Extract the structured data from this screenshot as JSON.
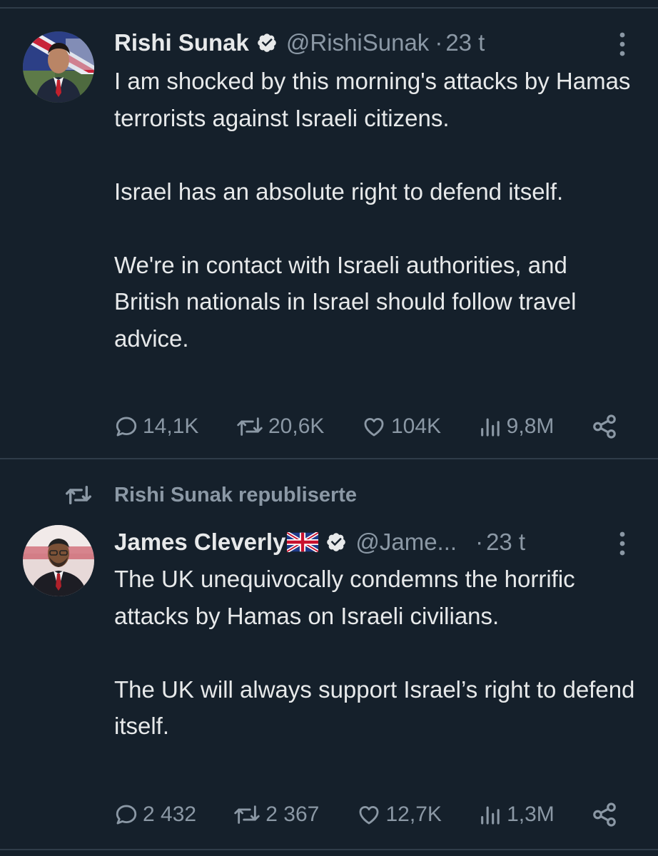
{
  "colors": {
    "background": "#15202b",
    "text_primary": "#e7e9ea",
    "text_secondary": "#8b98a5",
    "divider": "#2f3c49",
    "verified_badge": "#e7e9ea"
  },
  "tweets": [
    {
      "author_name": "Rishi Sunak",
      "handle": "@RishiSunak",
      "separator": "·",
      "time": "23 t",
      "verified": true,
      "avatar_icon": "portrait-avatar",
      "paragraphs": [
        "I am shocked by this morning's attacks by Hamas terrorists against Israeli citizens.",
        "Israel has an absolute right to defend itself.",
        "We're in contact with Israeli authorities, and British nationals in Israel should follow travel advice."
      ],
      "stats": {
        "replies": "14,1K",
        "reposts": "20,6K",
        "likes": "104K",
        "views": "9,8M"
      }
    },
    {
      "repost_context": "Rishi Sunak republiserte",
      "author_name": "James Cleverly",
      "name_flag": "uk-flag-emoji",
      "handle": "@Jame...",
      "separator": "·",
      "time": "23 t",
      "verified": true,
      "avatar_icon": "portrait-avatar",
      "paragraphs": [
        "The UK unequivocally condemns the horrific attacks by Hamas on Israeli civilians.",
        "The UK will always support Israel’s right to defend itself."
      ],
      "stats": {
        "replies": "2 432",
        "reposts": "2 367",
        "likes": "12,7K",
        "views": "1,3M"
      }
    }
  ]
}
